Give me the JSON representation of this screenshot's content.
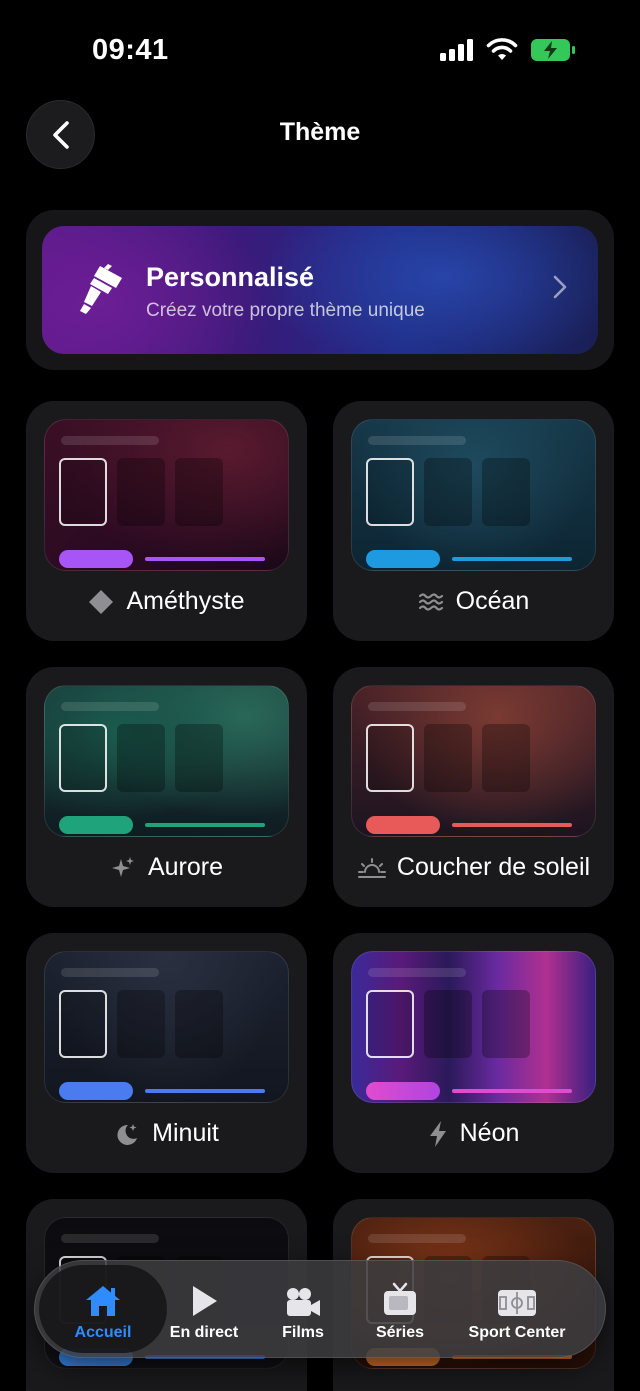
{
  "status_bar": {
    "time": "09:41"
  },
  "header": {
    "title": "Thème"
  },
  "custom_theme": {
    "title": "Personnalisé",
    "subtitle": "Créez votre propre thème unique"
  },
  "themes": [
    {
      "label": "Améthyste",
      "icon": "diamond-icon",
      "accent": "#a855f7"
    },
    {
      "label": "Océan",
      "icon": "waves-icon",
      "accent": "#1e9be0"
    },
    {
      "label": "Aurore",
      "icon": "sparkles-icon",
      "accent": "#1fa37a"
    },
    {
      "label": "Coucher de soleil",
      "icon": "sunset-icon",
      "accent": "#e85a5a"
    },
    {
      "label": "Minuit",
      "icon": "moon-stars-icon",
      "accent": "#4a7cf0"
    },
    {
      "label": "Néon",
      "icon": "bolt-icon",
      "accent": "#e04ccf"
    },
    {
      "label": "",
      "icon": "",
      "accent": "#3a8af0"
    },
    {
      "label": "",
      "icon": "",
      "accent": "#e07a2a"
    }
  ],
  "tab_bar": {
    "active": "Accueil",
    "tabs": [
      {
        "label": "Accueil",
        "icon": "house-icon"
      },
      {
        "label": "En direct",
        "icon": "play-icon"
      },
      {
        "label": "Films",
        "icon": "movie-camera-icon"
      },
      {
        "label": "Séries",
        "icon": "tv-icon"
      },
      {
        "label": "Sport Center",
        "icon": "stadium-icon"
      }
    ]
  },
  "colors": {
    "tab_active": "#2f8cff",
    "background": "#000000"
  }
}
